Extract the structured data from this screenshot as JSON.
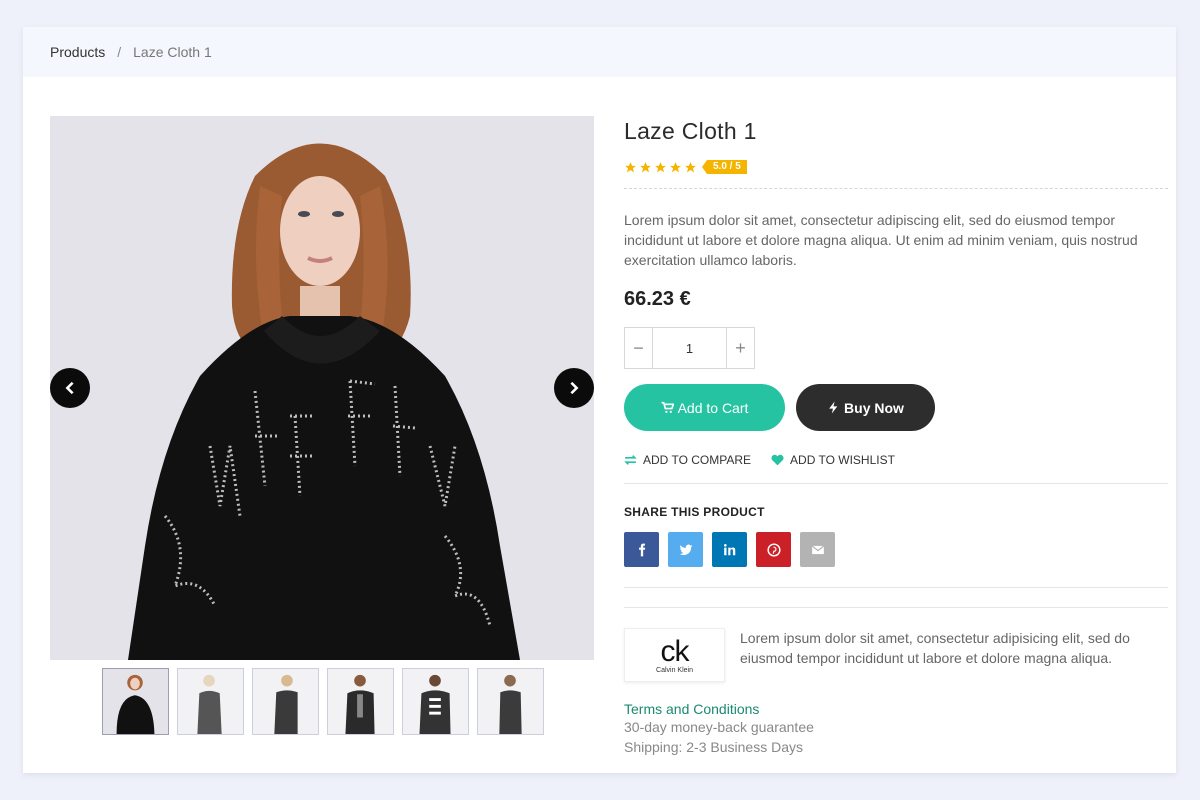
{
  "breadcrumb": {
    "parent": "Products",
    "separator": "/",
    "current": "Laze Cloth 1"
  },
  "product": {
    "title": "Laze Cloth 1",
    "rating": 5.0,
    "rating_label": "5.0 / 5",
    "stars": 5,
    "description": "Lorem ipsum dolor sit amet, consectetur adipiscing elit, sed do eiusmod tempor incididunt ut labore et dolore magna aliqua. Ut enim ad minim veniam, quis nostrud exercitation ullamco laboris.",
    "price": "66.23 €",
    "quantity": "1"
  },
  "buttons": {
    "add_to_cart": "Add to Cart",
    "buy_now": "Buy Now",
    "add_to_compare": "ADD TO COMPARE",
    "add_to_wishlist": "ADD TO WISHLIST"
  },
  "share": {
    "title": "SHARE THIS PRODUCT",
    "networks": [
      "facebook",
      "twitter",
      "linkedin",
      "pinterest",
      "email"
    ]
  },
  "brand": {
    "logo_mark": "ck",
    "logo_name": "Calvin Klein",
    "description": "Lorem ipsum dolor sit amet, consectetur adipisicing elit, sed do eiusmod tempor incididunt ut labore et dolore magna aliqua."
  },
  "policies": {
    "terms": "Terms and Conditions",
    "guarantee": "30-day money-back guarantee",
    "shipping": "Shipping: 2-3 Business Days"
  },
  "gallery": {
    "thumbnail_count": 6,
    "active_index": 0
  },
  "colors": {
    "accent": "#26c3a3",
    "dark_button": "#2d2d2d",
    "star": "#f5b400",
    "facebook": "#3b5998",
    "twitter": "#55acee",
    "linkedin": "#0077b5",
    "pinterest": "#cb2027",
    "email": "#b3b3b3"
  }
}
